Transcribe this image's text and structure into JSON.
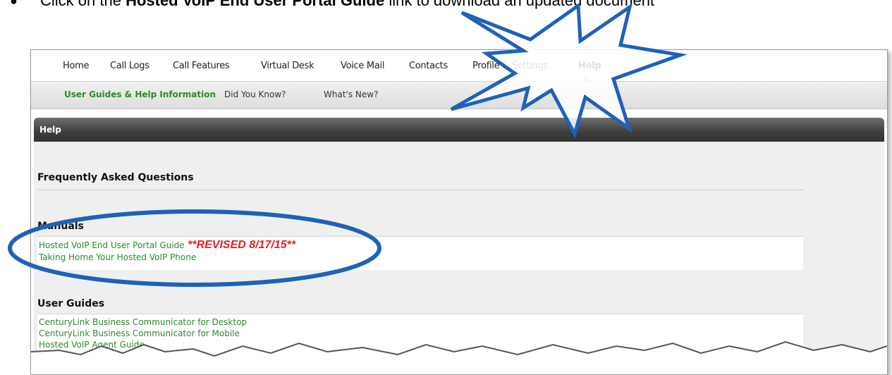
{
  "instruction": {
    "prefix": "Click on the ",
    "bold": "Hosted VoIP End User Portal Guide",
    "suffix": " link to download an updated document"
  },
  "topnav": {
    "items": [
      "Home",
      "Call Logs",
      "Call Features",
      "Virtual Desk",
      "Voice Mail",
      "Contacts",
      "Profile & Settings",
      "Help"
    ],
    "active": "Help"
  },
  "subnav": {
    "items": [
      "User Guides & Help Information",
      "Did You Know?",
      "What's New?"
    ],
    "active": "User Guides & Help Information"
  },
  "panel": {
    "title": "Help"
  },
  "sections": {
    "faq": {
      "title": "Frequently Asked Questions"
    },
    "manuals": {
      "title": "Manuals",
      "links": [
        {
          "text": "Hosted VoIP End User Portal Guide",
          "badge": "**REVISED 8/17/15**"
        },
        {
          "text": "Taking Home Your Hosted VoIP Phone"
        }
      ]
    },
    "user_guides": {
      "title": "User Guides",
      "links": [
        "CenturyLink Business Communicator for Desktop",
        "CenturyLink Business Communicator for Mobile",
        "Hosted VoIP Agent Guide"
      ]
    }
  },
  "colors": {
    "link_green": "#2a8a2a",
    "revised_red": "#e02020",
    "annotation_blue": "#1e62b8"
  }
}
